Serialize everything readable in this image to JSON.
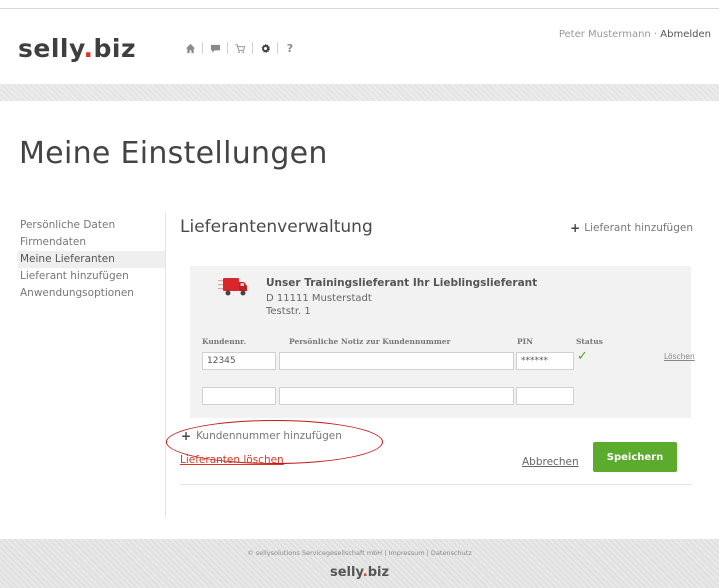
{
  "brand": {
    "name_part1": "selly",
    "dot": ".",
    "name_part2": "biz"
  },
  "nav_icons": [
    {
      "icon": "home-icon",
      "active": false
    },
    {
      "icon": "speech-bubble-icon",
      "active": false
    },
    {
      "icon": "cart-icon",
      "active": false
    },
    {
      "icon": "gear-icon",
      "active": true
    },
    {
      "icon": "help-icon",
      "label": "?",
      "active": false
    }
  ],
  "user": {
    "name": "Peter Mustermann",
    "separator": " · ",
    "logout_label": "Abmelden"
  },
  "page_title": "Meine Einstellungen",
  "sidebar": {
    "items": [
      {
        "label": "Persönliche Daten",
        "active": false
      },
      {
        "label": "Firmendaten",
        "active": false
      },
      {
        "label": "Meine Lieferanten",
        "active": true
      },
      {
        "label": "Lieferant hinzufügen",
        "active": false
      },
      {
        "label": "Anwendungsoptionen",
        "active": false
      }
    ]
  },
  "main": {
    "title": "Lieferantenverwaltung",
    "add_supplier_label": "Lieferant hinzufügen",
    "supplier": {
      "name": "Unser Trainingslieferant Ihr Lieblingslieferant",
      "city": "D 11111 Musterstadt",
      "street": "Teststr. 1"
    },
    "table": {
      "headers": {
        "customer_no": "Kundennr.",
        "note": "Persönliche Notiz zur Kundennummer",
        "pin": "PIN",
        "status": "Status"
      },
      "rows": [
        {
          "customer_no": "12345",
          "note": "",
          "pin": "******",
          "status": "ok",
          "delete_label": "Löschen"
        },
        {
          "customer_no": "",
          "note": "",
          "pin": ""
        }
      ]
    },
    "add_customer_label": "Kundennummer hinzufügen",
    "delete_supplier_label": "Lieferanten löschen",
    "cancel_label": "Abbrechen",
    "save_label": "Speichern"
  },
  "footer": {
    "text": "© sellysolutions Servicegesellschaft mbH | Impressum | Datenschutz",
    "logo": {
      "name_part1": "selly",
      "dot": ".",
      "name_part2": "biz"
    }
  },
  "colors": {
    "accent_red": "#d43a2a",
    "save_green": "#5cab2c",
    "status_green": "#5c9e1f",
    "annotation_red": "#c41919"
  }
}
